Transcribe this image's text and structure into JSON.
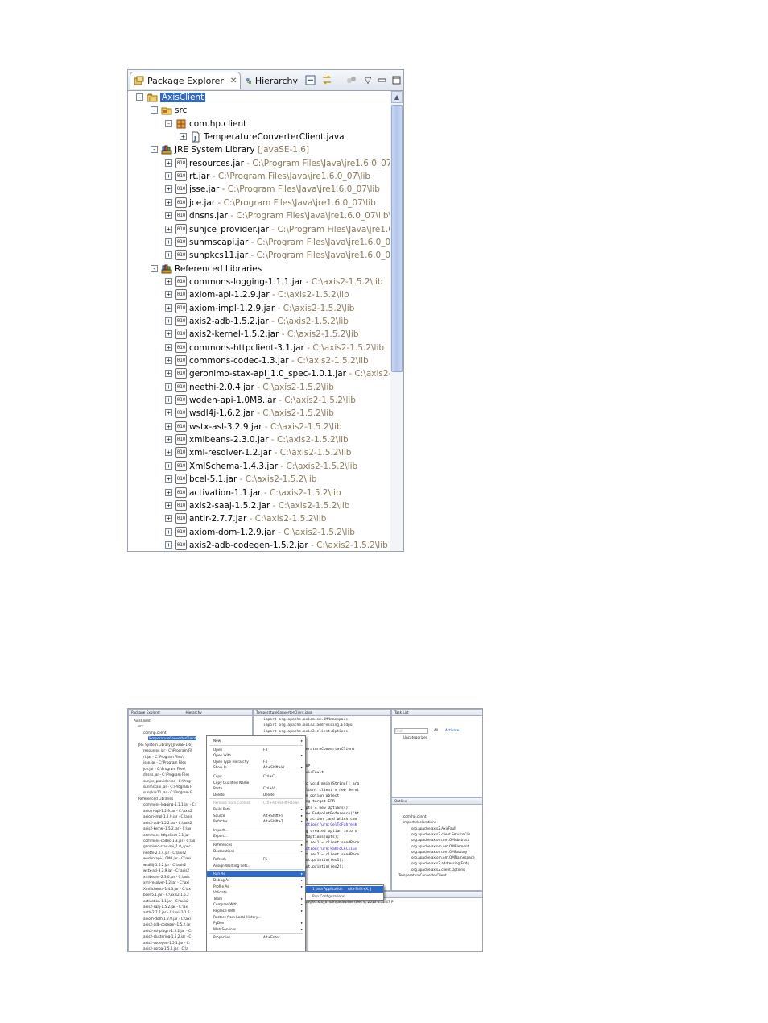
{
  "package_explorer": {
    "tabs": [
      {
        "label": "Package Explorer",
        "active": true,
        "icon": "package-explorer-icon"
      },
      {
        "label": "Hierarchy",
        "active": false,
        "icon": "hierarchy-icon"
      }
    ],
    "toolbar": [
      "collapse-all-icon",
      "link-with-editor-icon",
      "filter-icon",
      "view-menu-icon",
      "minimize-icon",
      "maximize-icon"
    ],
    "tree": [
      {
        "label": "AxisClient",
        "suffix": "",
        "indent": 0,
        "expander": "-",
        "icon": "project-icon",
        "selected": true
      },
      {
        "label": "src",
        "suffix": "",
        "indent": 1,
        "expander": "-",
        "icon": "source-folder-icon"
      },
      {
        "label": "com.hp.client",
        "suffix": "",
        "indent": 2,
        "expander": "-",
        "icon": "package-icon"
      },
      {
        "label": "TemperatureConverterClient.java",
        "suffix": "",
        "indent": 3,
        "expander": "+",
        "icon": "java-file-icon"
      },
      {
        "label": "JRE System Library",
        "suffix": " [JavaSE-1.6]",
        "indent": 1,
        "expander": "-",
        "icon": "library-icon"
      },
      {
        "label": "resources.jar",
        "suffix": " - C:\\Program Files\\Java\\jre1.6.0_07\\lib",
        "indent": 2,
        "expander": "+",
        "icon": "jar-icon"
      },
      {
        "label": "rt.jar",
        "suffix": " - C:\\Program Files\\Java\\jre1.6.0_07\\lib",
        "indent": 2,
        "expander": "+",
        "icon": "jar-icon"
      },
      {
        "label": "jsse.jar",
        "suffix": " - C:\\Program Files\\Java\\jre1.6.0_07\\lib",
        "indent": 2,
        "expander": "+",
        "icon": "jar-icon"
      },
      {
        "label": "jce.jar",
        "suffix": " - C:\\Program Files\\Java\\jre1.6.0_07\\lib",
        "indent": 2,
        "expander": "+",
        "icon": "jar-icon"
      },
      {
        "label": "dnsns.jar",
        "suffix": " - C:\\Program Files\\Java\\jre1.6.0_07\\lib\\ext",
        "indent": 2,
        "expander": "+",
        "icon": "jar-icon"
      },
      {
        "label": "sunjce_provider.jar",
        "suffix": " - C:\\Program Files\\Java\\jre1.6.0",
        "indent": 2,
        "expander": "+",
        "icon": "jar-icon"
      },
      {
        "label": "sunmscapi.jar",
        "suffix": " - C:\\Program Files\\Java\\jre1.6.0_07\\lib",
        "indent": 2,
        "expander": "+",
        "icon": "jar-icon"
      },
      {
        "label": "sunpkcs11.jar",
        "suffix": " - C:\\Program Files\\Java\\jre1.6.0_07\\lib",
        "indent": 2,
        "expander": "+",
        "icon": "jar-icon"
      },
      {
        "label": "Referenced Libraries",
        "suffix": "",
        "indent": 1,
        "expander": "-",
        "icon": "library-icon"
      },
      {
        "label": "commons-logging-1.1.1.jar",
        "suffix": " - C:\\axis2-1.5.2\\lib",
        "indent": 2,
        "expander": "+",
        "icon": "jar-icon"
      },
      {
        "label": "axiom-api-1.2.9.jar",
        "suffix": " - C:\\axis2-1.5.2\\lib",
        "indent": 2,
        "expander": "+",
        "icon": "jar-icon"
      },
      {
        "label": "axiom-impl-1.2.9.jar",
        "suffix": " - C:\\axis2-1.5.2\\lib",
        "indent": 2,
        "expander": "+",
        "icon": "jar-icon"
      },
      {
        "label": "axis2-adb-1.5.2.jar",
        "suffix": " - C:\\axis2-1.5.2\\lib",
        "indent": 2,
        "expander": "+",
        "icon": "jar-icon"
      },
      {
        "label": "axis2-kernel-1.5.2.jar",
        "suffix": " - C:\\axis2-1.5.2\\lib",
        "indent": 2,
        "expander": "+",
        "icon": "jar-icon"
      },
      {
        "label": "commons-httpclient-3.1.jar",
        "suffix": " - C:\\axis2-1.5.2\\lib",
        "indent": 2,
        "expander": "+",
        "icon": "jar-icon"
      },
      {
        "label": "commons-codec-1.3.jar",
        "suffix": " - C:\\axis2-1.5.2\\lib",
        "indent": 2,
        "expander": "+",
        "icon": "jar-icon"
      },
      {
        "label": "geronimo-stax-api_1.0_spec-1.0.1.jar",
        "suffix": " - C:\\axis2-1.5",
        "indent": 2,
        "expander": "+",
        "icon": "jar-icon"
      },
      {
        "label": "neethi-2.0.4.jar",
        "suffix": " - C:\\axis2-1.5.2\\lib",
        "indent": 2,
        "expander": "+",
        "icon": "jar-icon"
      },
      {
        "label": "woden-api-1.0M8.jar",
        "suffix": " - C:\\axis2-1.5.2\\lib",
        "indent": 2,
        "expander": "+",
        "icon": "jar-icon"
      },
      {
        "label": "wsdl4j-1.6.2.jar",
        "suffix": " - C:\\axis2-1.5.2\\lib",
        "indent": 2,
        "expander": "+",
        "icon": "jar-icon"
      },
      {
        "label": "wstx-asl-3.2.9.jar",
        "suffix": " - C:\\axis2-1.5.2\\lib",
        "indent": 2,
        "expander": "+",
        "icon": "jar-icon"
      },
      {
        "label": "xmlbeans-2.3.0.jar",
        "suffix": " - C:\\axis2-1.5.2\\lib",
        "indent": 2,
        "expander": "+",
        "icon": "jar-icon"
      },
      {
        "label": "xml-resolver-1.2.jar",
        "suffix": " - C:\\axis2-1.5.2\\lib",
        "indent": 2,
        "expander": "+",
        "icon": "jar-icon"
      },
      {
        "label": "XmlSchema-1.4.3.jar",
        "suffix": " - C:\\axis2-1.5.2\\lib",
        "indent": 2,
        "expander": "+",
        "icon": "jar-icon"
      },
      {
        "label": "bcel-5.1.jar",
        "suffix": " - C:\\axis2-1.5.2\\lib",
        "indent": 2,
        "expander": "+",
        "icon": "jar-icon"
      },
      {
        "label": "activation-1.1.jar",
        "suffix": " - C:\\axis2-1.5.2\\lib",
        "indent": 2,
        "expander": "+",
        "icon": "jar-icon"
      },
      {
        "label": "axis2-saaj-1.5.2.jar",
        "suffix": " - C:\\axis2-1.5.2\\lib",
        "indent": 2,
        "expander": "+",
        "icon": "jar-icon"
      },
      {
        "label": "antlr-2.7.7.jar",
        "suffix": " - C:\\axis2-1.5.2\\lib",
        "indent": 2,
        "expander": "+",
        "icon": "jar-icon"
      },
      {
        "label": "axiom-dom-1.2.9.jar",
        "suffix": " - C:\\axis2-1.5.2\\lib",
        "indent": 2,
        "expander": "+",
        "icon": "jar-icon"
      },
      {
        "label": "axis2-adb-codegen-1.5.2.jar",
        "suffix": " - C:\\axis2-1.5.2\\lib",
        "indent": 2,
        "expander": "+",
        "icon": "jar-icon"
      }
    ]
  },
  "ide_screenshot": {
    "left_tabs": {
      "package_explorer": "Package Explorer",
      "hierarchy": "Hierarchy"
    },
    "editor_tab": "TemperatureConverterClient.java",
    "tasklist_tab": "Task List",
    "outline_tab": "Outline",
    "tasklist_items": [
      "All",
      "Activate...",
      "Uncategorized"
    ],
    "tasklist_find": "Find",
    "mini_tree": [
      "AxisClient",
      "src",
      "com.hp.client",
      "TemperatureConverterClient",
      "JRE System Library [JavaSE-1.6]",
      "resources.jar - C:\\Program Fil",
      "rt.jar - C:\\Program Files\\",
      "jsse.jar - C:\\Program Files",
      "jce.jar - C:\\Program Files\\",
      "dnsns.jar - C:\\Program Files",
      "sunjce_provider.jar - C:\\Prog",
      "sunmscapi.jar - C:\\Program F",
      "sunpkcs11.jar - C:\\Program F",
      "Referenced Libraries",
      "commons-logging-1.1.1.jar - C:",
      "axiom-api-1.2.9.jar - C:\\axis2",
      "axiom-impl-1.2.9.jar - C:\\axis",
      "axis2-adb-1.5.2.jar - C:\\axis2",
      "axis2-kernel-1.5.2.jar - C:\\ax",
      "commons-httpclient-3.1.jar",
      "commons-codec-1.3.jar - C:\\ax",
      "geronimo-stax-api_1.0_spec",
      "neethi-2.0.4.jar - C:\\axis2",
      "woden-api-1.0M8.jar - C:\\axi",
      "wsdl4j-1.6.2.jar - C:\\axis2",
      "wstx-asl-3.2.9.jar - C:\\axis2",
      "xmlbeans-2.3.0.jar - C:\\axis",
      "xml-resolver-1.2.jar - C:\\axi",
      "XmlSchema-1.4.3.jar - C:\\ax",
      "bcel-5.1.jar - C:\\axis2-1.5.2",
      "activation-1.1.jar - C:\\axis2",
      "axis2-saaj-1.5.2.jar - C:\\ax",
      "antlr-2.7.7.jar - C:\\axis2-1.5",
      "axiom-dom-1.2.9.jar - C:\\axi",
      "axis2-adb-codegen-1.5.2.jar",
      "axis2-xsl-plugin-1.5.2.jar - C:",
      "axis2-clustering-1.5.2.jar - C",
      "axis2-codegen-1.5.1.jar - C:",
      "axis2-corba-1.5.2.jar - C:\\a"
    ],
    "code_lines": [
      "import org.apache.axiom.om.OMNamespace;",
      "import org.apache.axis2.addressing.Endpo",
      "import org.apache.axis2.client.Options;",
      "",
      "",
      "peratureConverterClient",
      "",
      "",
      "IUP",
      "AxisFault",
      "",
      "ic void main(String[] arg",
      "Client client = new Servi",
      "he option object",
      "ing target EPR",
      "opts = new Options();",
      "new EndpointReference(\"ht",
      "ng action ,and which can",
      "Action(\"urn:CelToFahrenh",
      "ng created option into s",
      "etOptions(opts);",
      "nt res1 = client.sendRece",
      "Action(\"urn:FahToCelsius",
      "nt res2 = client.sendRece",
      "out.println(res1);",
      "out.println(res2);"
    ],
    "outline_items": [
      "com.hp.client",
      "import declarations",
      "org.apache.axis2.AxisFault",
      "org.apache.axis2.client.ServiceClie",
      "org.apache.axiom.om.OMAbstract",
      "org.apache.axiom.om.OMElement",
      "org.apache.axiom.om.OMFactory",
      "org.apache.axiom.om.OMNamespace",
      "org.apache.axis2.addressing.Endp",
      "org.apache.axis2.client.Options",
      "TemperatureConverterClient"
    ],
    "console_line": "va\\jre1.6.0_07\\bin\\javaw.exe (Dec 9, 2010 6:52:47 P",
    "context_menu": [
      {
        "label": "New",
        "key": "",
        "arrow": true
      },
      {
        "sep": true
      },
      {
        "label": "Open",
        "key": "F3"
      },
      {
        "label": "Open With",
        "key": "",
        "arrow": true
      },
      {
        "label": "Open Type Hierarchy",
        "key": "F4"
      },
      {
        "label": "Show In",
        "key": "Alt+Shift+W",
        "arrow": true
      },
      {
        "sep": true
      },
      {
        "label": "Copy",
        "key": "Ctrl+C"
      },
      {
        "label": "Copy Qualified Name",
        "key": ""
      },
      {
        "label": "Paste",
        "key": "Ctrl+V"
      },
      {
        "label": "Delete",
        "key": "Delete"
      },
      {
        "sep": true
      },
      {
        "label": "Remove from Context",
        "key": "Ctrl+Alt+Shift+Down",
        "disabled": true
      },
      {
        "label": "Build Path",
        "key": "",
        "arrow": true
      },
      {
        "label": "Source",
        "key": "Alt+Shift+S",
        "arrow": true
      },
      {
        "label": "Refactor",
        "key": "Alt+Shift+T",
        "arrow": true
      },
      {
        "sep": true
      },
      {
        "label": "Import...",
        "key": ""
      },
      {
        "label": "Export...",
        "key": ""
      },
      {
        "sep": true
      },
      {
        "label": "References",
        "key": "",
        "arrow": true
      },
      {
        "label": "Declarations",
        "key": "",
        "arrow": true
      },
      {
        "sep": true
      },
      {
        "label": "Refresh",
        "key": "F5"
      },
      {
        "label": "Assign Working Sets...",
        "key": ""
      },
      {
        "sep": true
      },
      {
        "label": "Run As",
        "key": "",
        "arrow": true,
        "highlight": true
      },
      {
        "label": "Debug As",
        "key": "",
        "arrow": true
      },
      {
        "label": "Profile As",
        "key": "",
        "arrow": true
      },
      {
        "label": "Validate",
        "key": ""
      },
      {
        "label": "Team",
        "key": "",
        "arrow": true
      },
      {
        "label": "Compare With",
        "key": "",
        "arrow": true
      },
      {
        "label": "Replace With",
        "key": "",
        "arrow": true
      },
      {
        "label": "Restore from Local History...",
        "key": ""
      },
      {
        "label": "PyDev",
        "key": "",
        "arrow": true
      },
      {
        "label": "Web Services",
        "key": "",
        "arrow": true
      },
      {
        "sep": true
      },
      {
        "label": "Properties",
        "key": "Alt+Enter"
      }
    ],
    "submenu": [
      {
        "label": "1 Java Application",
        "key": "Alt+Shift+X, J",
        "highlight": true
      },
      {
        "label": "Run Configurations...",
        "key": ""
      }
    ]
  }
}
